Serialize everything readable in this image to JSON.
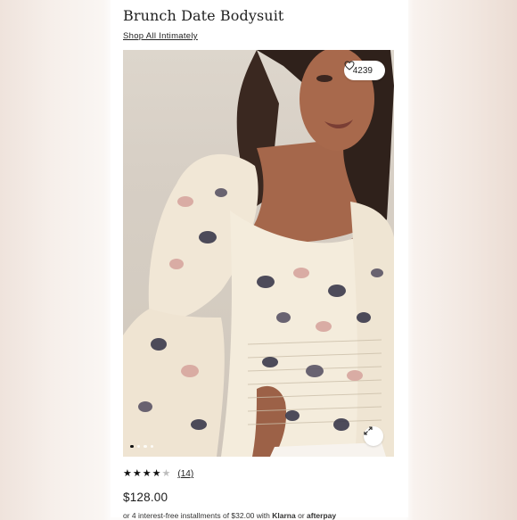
{
  "product": {
    "title": "Brunch Date Bodysuit",
    "shop_link": "Shop All Intimately",
    "likes": "4239",
    "rating": 4,
    "rating_max": 5,
    "review_count": "(14)",
    "price": "$128.00",
    "installments_text": "or 4 interest-free installments of $32.00 with",
    "klarna_label": "Klarna",
    "or_text": "or",
    "afterpay_label": "afterpay"
  },
  "gallery": {
    "image_count": 4,
    "active_index": 0
  },
  "icons": {
    "like": "heart-outline-icon",
    "expand": "expand-arrows-icon",
    "info": "info-icon"
  },
  "colors": {
    "image_background": "#d6cec3",
    "blouse": "#f3ead9",
    "print_dark": "#3b3a4c",
    "print_pink": "#d7a69f"
  }
}
